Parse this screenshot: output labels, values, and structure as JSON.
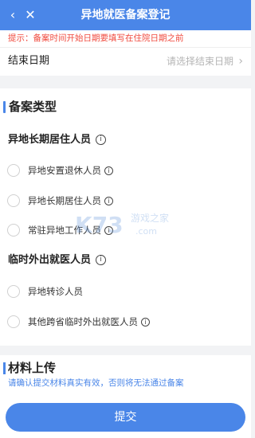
{
  "header": {
    "back_icon": "‹",
    "close_icon": "✕",
    "title": "异地就医备案登记"
  },
  "notice": "提示：备案时间开始日期要填写在住院日期之前",
  "end_date": {
    "label": "结束日期",
    "placeholder": "请选择结束日期",
    "chevron": "›"
  },
  "filing_type": {
    "title": "备案类型",
    "long_term": {
      "title": "异地长期居住人员",
      "options": [
        {
          "label": "异地安置退休人员"
        },
        {
          "label": "异地长期居住人员"
        },
        {
          "label": "常驻异地工作人员"
        }
      ]
    },
    "temporary": {
      "title": "临时外出就医人员",
      "options": [
        {
          "label": "异地转诊人员"
        },
        {
          "label": "其他跨省临时外出就医人员"
        }
      ]
    }
  },
  "watermark": {
    "logo": "K73",
    "text_cn": "游戏之家",
    "text_en": ".com"
  },
  "materials": {
    "title": "材料上传",
    "hint": "请确认提交材料真实有效，否则将无法通过备案"
  },
  "submit_label": "提交",
  "colors": {
    "primary": "#4a86e8",
    "warning": "#f04a3e",
    "placeholder": "#b5b5b5"
  }
}
